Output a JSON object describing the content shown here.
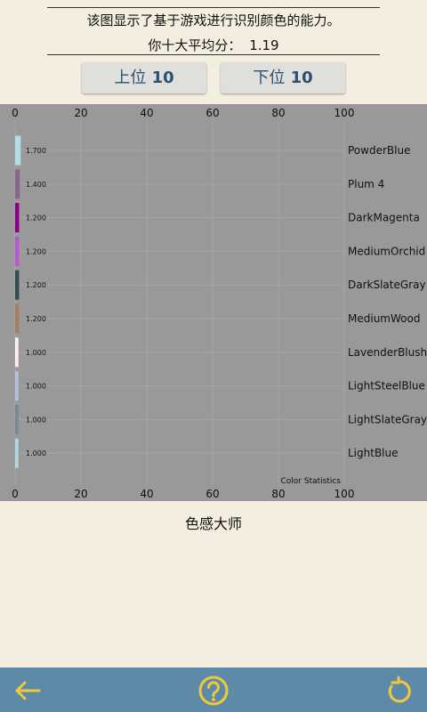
{
  "header": {
    "description": "该图显示了基于游戏进行识别颜色的能力。",
    "average_label": "你十大平均分：",
    "average_value": "1.19"
  },
  "buttons": {
    "top10_word": "上位",
    "top10_num": "10",
    "bottom10_word": "下位",
    "bottom10_num": "10"
  },
  "chart_data": {
    "type": "bar",
    "orientation": "horizontal",
    "xlim": [
      0,
      100
    ],
    "xticks": [
      "0",
      "20",
      "40",
      "60",
      "80",
      "100"
    ],
    "grid": true,
    "caption": "Color Statistics",
    "categories": [
      "PowderBlue",
      "Plum 4",
      "DarkMagenta",
      "MediumOrchid",
      "DarkSlateGray",
      "MediumWood",
      "LavenderBlush",
      "LightSteelBlue",
      "LightSlateGray",
      "LightBlue"
    ],
    "values": [
      1.7,
      1.4,
      1.2,
      1.2,
      1.2,
      1.2,
      1.0,
      1.0,
      1.0,
      1.0
    ],
    "value_labels": [
      "1.700",
      "1.400",
      "1.200",
      "1.200",
      "1.200",
      "1.200",
      "1.000",
      "1.000",
      "1.000",
      "1.000"
    ],
    "colors": [
      "#b0e0e6",
      "#8b668b",
      "#8b008b",
      "#ba55d3",
      "#2f4f4f",
      "#a68064",
      "#fff0f5",
      "#b0c4de",
      "#778899",
      "#add8e6"
    ]
  },
  "footer": {
    "title": "色感大师"
  },
  "bottom_bar": {
    "icons": [
      "back-arrow-icon",
      "help-icon",
      "refresh-icon"
    ],
    "color": "#5e8aaa"
  }
}
